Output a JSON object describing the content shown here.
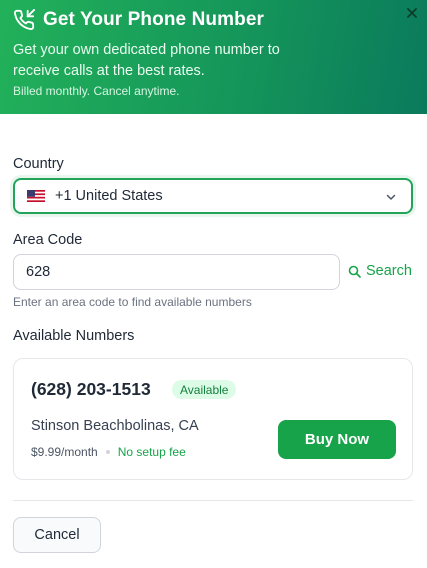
{
  "header": {
    "title": "Get Your Phone Number",
    "subtitle": "Get your own dedicated phone number to receive calls at the best rates.",
    "billing_note": "Billed monthly. Cancel anytime.",
    "icon": "phone-incoming-icon",
    "close_icon": "close-icon"
  },
  "form": {
    "country_label": "Country",
    "country_value": "+1 United States",
    "country_flag": "us-flag-icon",
    "area_code_label": "Area Code",
    "area_code_value": "628",
    "search_label": "Search",
    "hint": "Enter an area code to find available numbers"
  },
  "results": {
    "heading": "Available Numbers",
    "numbers": [
      {
        "number": "(628) 203-1513",
        "status": "Available",
        "location": "Stinson Beachbolinas, CA",
        "price": "$9.99/month",
        "fee_note": "No setup fee",
        "buy_label": "Buy Now"
      }
    ]
  },
  "footer": {
    "cancel_label": "Cancel"
  },
  "colors": {
    "accent": "#16a34a",
    "header_gradient_start": "#22b15a",
    "header_gradient_end": "#0a7a5c",
    "badge_bg": "#dcfce7"
  }
}
